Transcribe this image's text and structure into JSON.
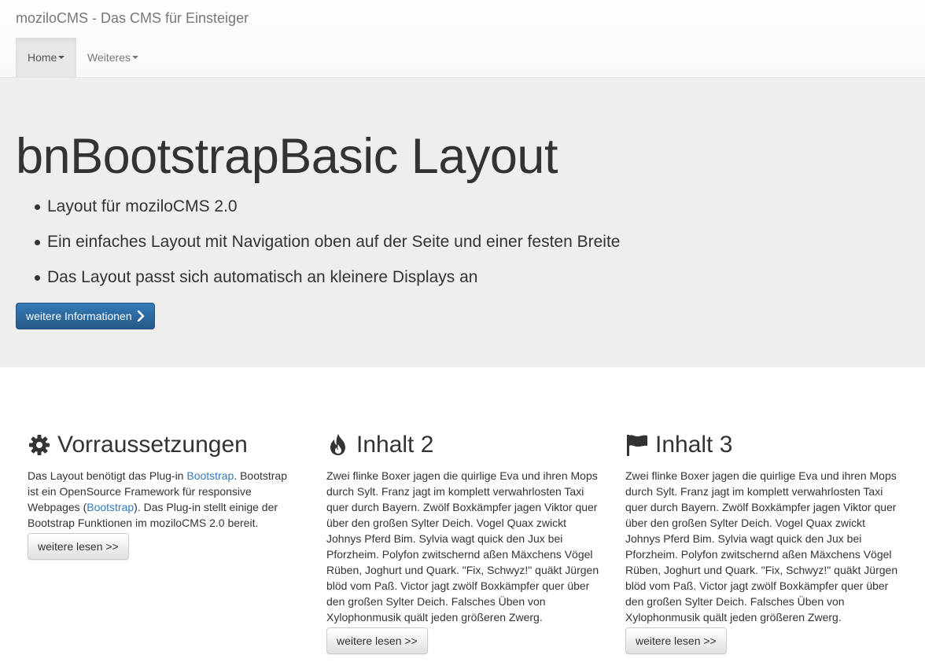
{
  "brand": "moziloCMS - Das CMS für Einsteiger",
  "nav": [
    {
      "label": "Home"
    },
    {
      "label": "Weiteres"
    }
  ],
  "jumbotron": {
    "title": "bnBootstrapBasic Layout",
    "items": [
      "Layout für moziloCMS 2.0",
      "Ein einfaches Layout mit Navigation oben auf der Seite und einer festen Breite",
      "Das Layout passt sich automatisch an kleinere Displays an"
    ],
    "button_label": "weitere Informationen",
    "button_icon": "chevron-right-icon"
  },
  "columns": [
    {
      "icon": "gear-icon",
      "title": "Vorraussetzungen",
      "text_parts": [
        "Das Layout benötigt das Plug-in ",
        "Bootstrap",
        ". Bootstrap ist ein OpenSource Framework für responsive Webpages (",
        "Bootstrap",
        "). Das Plug-in stellt einige der Bootstrap Funktionen im moziloCMS 2.0 bereit."
      ],
      "button_label": "weitere lesen >>"
    },
    {
      "icon": "fire-icon",
      "title": "Inhalt 2",
      "text": "Zwei flinke Boxer jagen die quirlige Eva und ihren Mops durch Sylt. Franz jagt im komplett verwahrlosten Taxi quer durch Bayern. Zwölf Boxkämpfer jagen Viktor quer über den großen Sylter Deich. Vogel Quax zwickt Johnys Pferd Bim. Sylvia wagt quick den Jux bei Pforzheim. Polyfon zwitschernd aßen Mäxchens Vögel Rüben, Joghurt und Quark. \"Fix, Schwyz!\" quäkt Jürgen blöd vom Paß. Victor jagt zwölf Boxkämpfer quer über den großen Sylter Deich. Falsches Üben von Xylophonmusik quält jeden größeren Zwerg.",
      "button_label": "weitere lesen >>"
    },
    {
      "icon": "flag-icon",
      "title": "Inhalt 3",
      "text": "Zwei flinke Boxer jagen die quirlige Eva und ihren Mops durch Sylt. Franz jagt im komplett verwahrlosten Taxi quer durch Bayern. Zwölf Boxkämpfer jagen Viktor quer über den großen Sylter Deich. Vogel Quax zwickt Johnys Pferd Bim. Sylvia wagt quick den Jux bei Pforzheim. Polyfon zwitschernd aßen Mäxchens Vögel Rüben, Joghurt und Quark. \"Fix, Schwyz!\" quäkt Jürgen blöd vom Paß. Victor jagt zwölf Boxkämpfer quer über den großen Sylter Deich. Falsches Üben von Xylophonmusik quält jeden größeren Zwerg.",
      "button_label": "weitere lesen >>"
    }
  ],
  "colors": {
    "primary": "#337ab7",
    "jumbotron_bg": "#eeeeee",
    "link": "#337ab7"
  }
}
